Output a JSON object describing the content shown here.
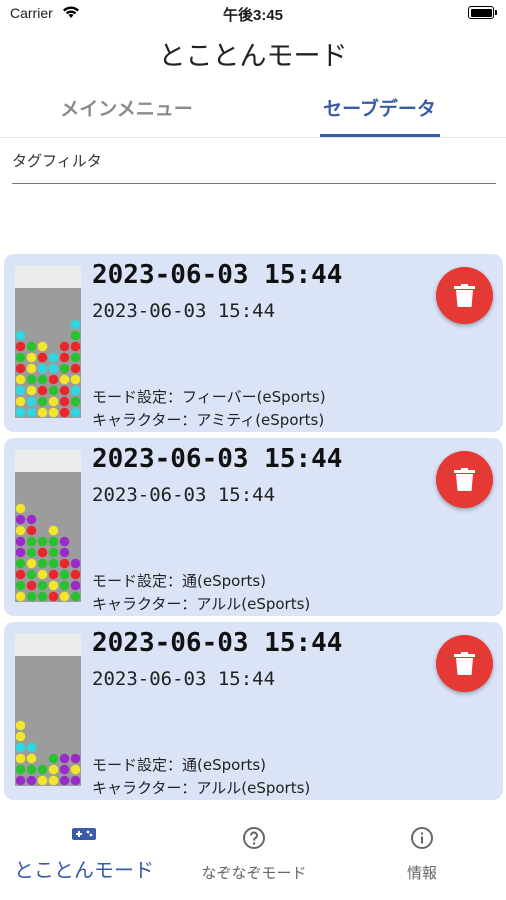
{
  "status_bar": {
    "carrier": "Carrier",
    "time": "午後3:45"
  },
  "app_title": "とことんモード",
  "tabs": [
    {
      "label": "メインメニュー",
      "selected": false
    },
    {
      "label": "セーブデータ",
      "selected": true
    }
  ],
  "filter": {
    "label": "タグフィルタ",
    "value": ""
  },
  "saves": [
    {
      "title": "2023-06-03  15:44",
      "date": "2023-06-03  15:44",
      "mode_label": "モード設定：",
      "mode_value": "フィーバー(eSports)",
      "character_label": "キャラクター：",
      "character_value": "アミティ(eSports)",
      "board": [
        "......",
        "......",
        ".....c",
        "c....g",
        "rgy.rr",
        "gyrcrg",
        "ryccgr",
        "yggryy",
        "cyrgrc",
        "ycgyrg",
        "ccyyrc"
      ]
    },
    {
      "title": "2023-06-03  15:44",
      "date": "2023-06-03  15:44",
      "mode_label": "モード設定：",
      "mode_value": "通(eSports)",
      "character_label": "キャラクター：",
      "character_value": "アルル(eSports)",
      "board": [
        "......",
        "......",
        "y.....",
        "pp....",
        "yr.y..",
        "pgggp.",
        "pgrgp.",
        "gyggrp",
        "rgyrgr",
        "grgygp",
        "yggryg"
      ]
    },
    {
      "title": "2023-06-03  15:44",
      "date": "2023-06-03  15:44",
      "mode_label": "モード設定：",
      "mode_value": "通(eSports)",
      "character_label": "キャラクター：",
      "character_value": "アルル(eSports)",
      "board": [
        "......",
        "......",
        "......",
        "......",
        "......",
        "......",
        "y.....",
        "y.....",
        "cc....",
        "yy.gpp",
        "gggypy",
        "ppyypp"
      ]
    }
  ],
  "puyo_colors": {
    "r": "#e8262c",
    "g": "#29c12f",
    "y": "#f2e62a",
    "c": "#30d6e0",
    "p": "#9a2bc9"
  },
  "bottom_nav": [
    {
      "label": "とことんモード",
      "icon": "gamepad-icon",
      "active": true
    },
    {
      "label": "なぞなぞモード",
      "icon": "help-circle-icon",
      "active": false
    },
    {
      "label": "情報",
      "icon": "info-icon",
      "active": false
    }
  ],
  "colors": {
    "accent": "#3b5ba8",
    "card_bg": "#dbe3f6",
    "delete": "#e53935"
  }
}
